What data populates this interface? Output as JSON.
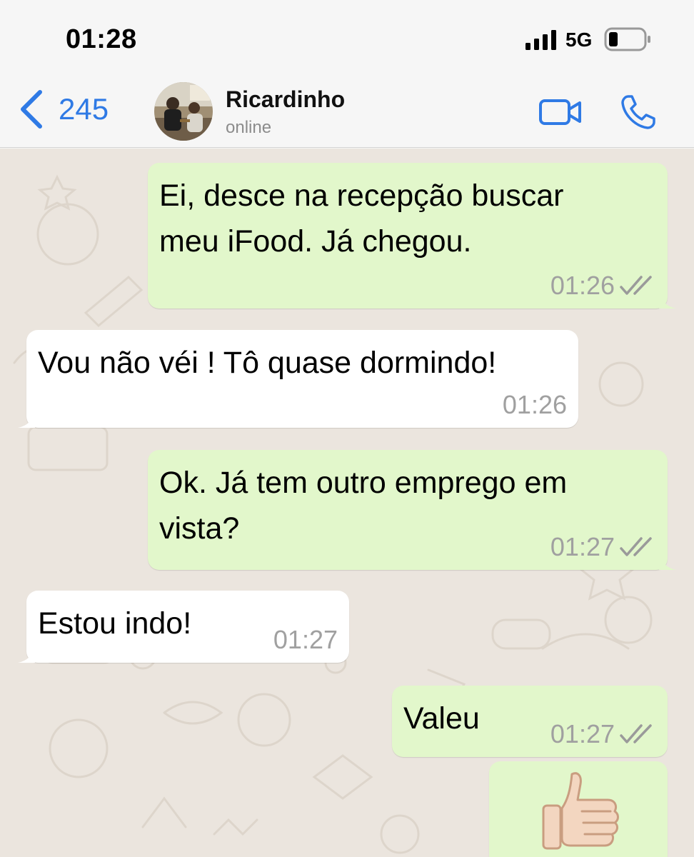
{
  "status_bar": {
    "time": "01:28",
    "network": "5G",
    "icons": [
      "signal-icon",
      "battery-icon"
    ]
  },
  "header": {
    "back_count": "245",
    "contact_name": "Ricardinho",
    "contact_status": "online",
    "icons": [
      "back-chevron-icon",
      "video-camera-icon",
      "phone-icon"
    ],
    "accent_color": "#2f7ae5"
  },
  "colors": {
    "outgoing_bubble": "#e2f7cb",
    "incoming_bubble": "#ffffff",
    "chat_background": "#ebe5de"
  },
  "messages": [
    {
      "direction": "outgoing",
      "lines": [
        "Ei, desce na recepção buscar",
        "meu iFood. Já chegou."
      ],
      "time": "01:26",
      "read": true
    },
    {
      "direction": "incoming",
      "lines": [
        "Vou não véi ! Tô quase dormindo!"
      ],
      "time": "01:26"
    },
    {
      "direction": "outgoing",
      "lines": [
        "Ok. Já tem outro emprego em",
        "vista?"
      ],
      "time": "01:27",
      "read": true
    },
    {
      "direction": "incoming",
      "lines": [
        "Estou indo!"
      ],
      "time": "01:27"
    },
    {
      "direction": "outgoing",
      "lines": [
        "Valeu"
      ],
      "time": "01:27",
      "read": true
    },
    {
      "direction": "outgoing",
      "emoji": "thumbs-up-icon"
    }
  ]
}
